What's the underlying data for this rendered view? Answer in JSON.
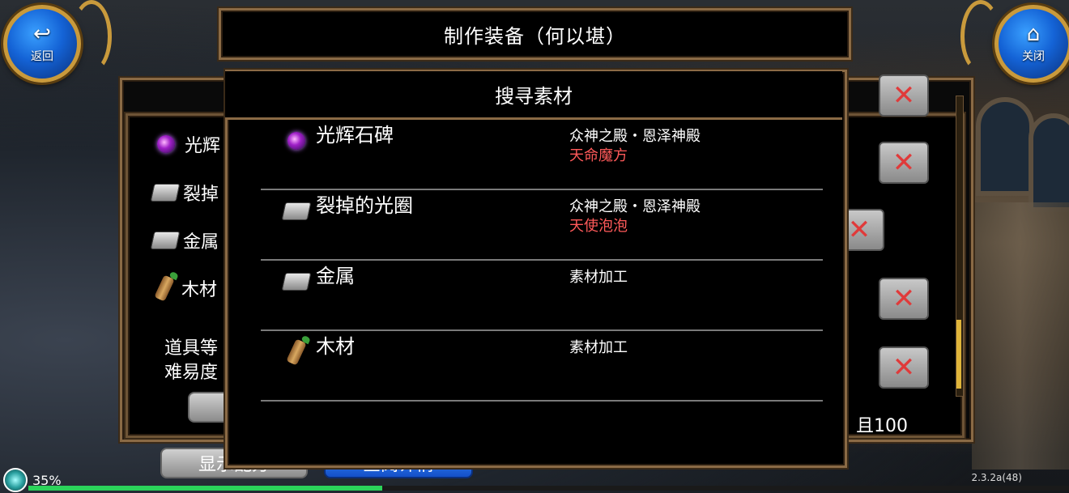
{
  "top_left_button": {
    "label": "返回",
    "icon": "back-arrow-icon"
  },
  "top_right_button": {
    "label": "关闭",
    "icon": "home-icon"
  },
  "window_title": "制作装备（何以堪）",
  "materials_panel": {
    "items": [
      {
        "name": "光辉",
        "icon": "purple-gem-icon"
      },
      {
        "name": "裂掉",
        "icon": "silver-ingot-icon"
      },
      {
        "name": "金属",
        "icon": "silver-ingot-icon"
      },
      {
        "name": "木材",
        "icon": "wood-icon"
      }
    ],
    "info_line1": "道具等",
    "info_line2": "难易度",
    "right_text": "，且100",
    "remove_button_count": 5
  },
  "bottom_buttons": {
    "show_recipe": "显示配方",
    "view_details": "查阅详情"
  },
  "dialog": {
    "title": "搜寻素材",
    "rows": [
      {
        "name": "光辉石碑",
        "icon": "purple-gem-icon",
        "source": "众神之殿・恩泽神殿",
        "source2": "天命魔方"
      },
      {
        "name": "裂掉的光圈",
        "icon": "silver-ingot-icon",
        "source": "众神之殿・恩泽神殿",
        "source2": "天使泡泡"
      },
      {
        "name": "金属",
        "icon": "silver-ingot-icon",
        "source": "素材加工",
        "source2": ""
      },
      {
        "name": "木材",
        "icon": "wood-icon",
        "source": "素材加工",
        "source2": ""
      }
    ]
  },
  "status": {
    "battery": "35%",
    "version": "2.3.2a(48)",
    "xp_progress": 0.34
  },
  "colors": {
    "frame": "#8a6a45",
    "source_highlight": "#ff5a5a",
    "xp": "#2bd35a"
  }
}
